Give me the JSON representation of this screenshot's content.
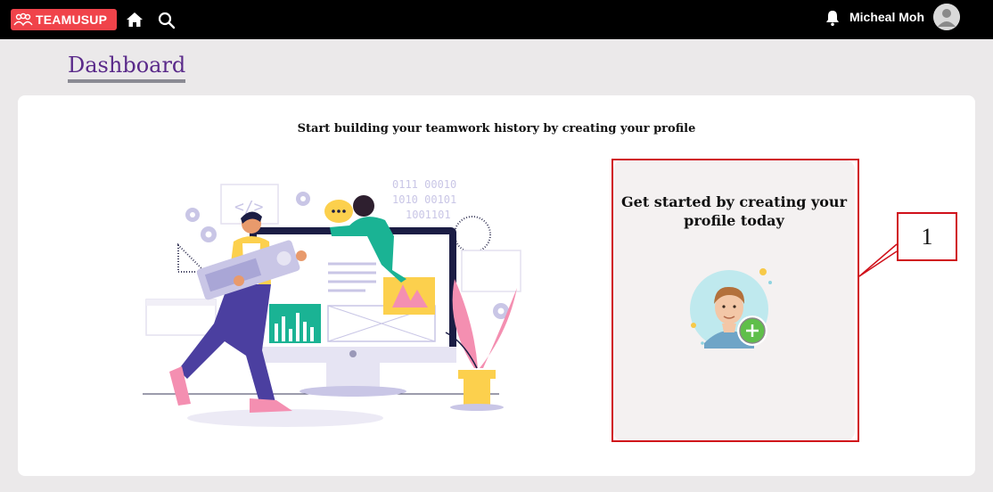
{
  "topbar": {
    "logo_text": "TEAMUSUP",
    "user_name": "Micheal Moh",
    "colors": {
      "background": "#000000",
      "logo": "#f0434a"
    }
  },
  "page": {
    "title": "Dashboard",
    "title_color": "#5a2a8a"
  },
  "card": {
    "heading": "Start building your teamwork history by creating your profile"
  },
  "profile_card": {
    "title_line1": "Get started by creating your",
    "title_line2": "profile today"
  },
  "illustration": {
    "binary_line1": "0111 00010",
    "binary_line2": "1010 00101",
    "binary_line3": "1001101"
  },
  "annotation": {
    "label": "1",
    "color": "#d0101a"
  },
  "icons": {
    "home": "home-icon",
    "search": "search-icon",
    "bell": "bell-icon",
    "avatar": "user-avatar-icon",
    "add": "plus-icon"
  }
}
